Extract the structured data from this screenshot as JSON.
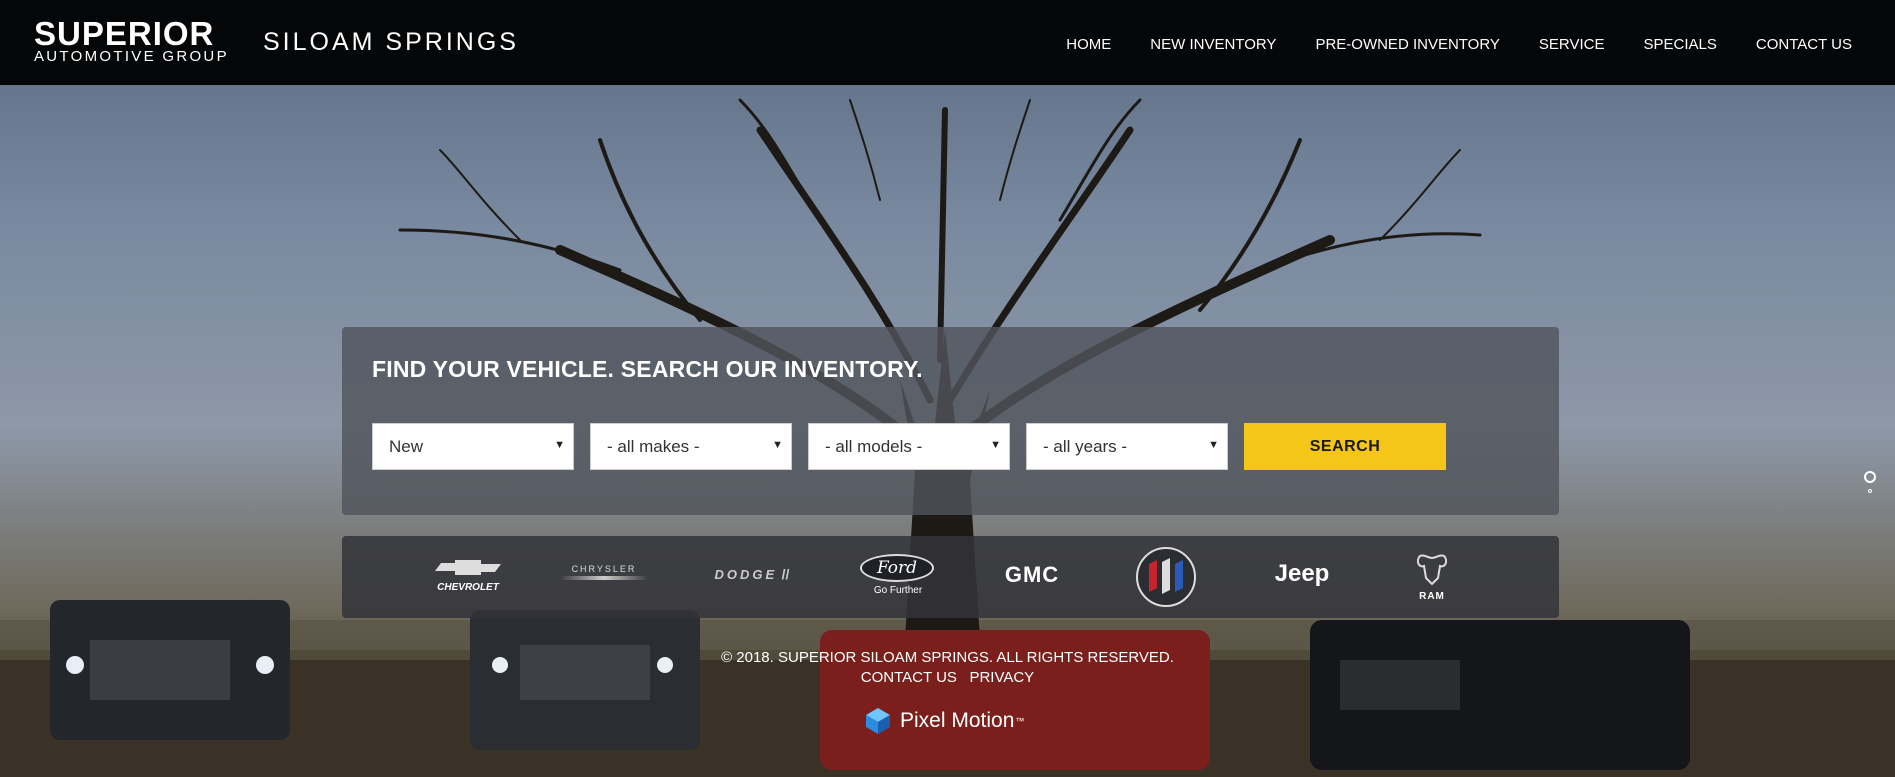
{
  "header": {
    "logo_top": "SUPERIOR",
    "logo_bottom": "AUTOMOTIVE GROUP",
    "location": "SILOAM SPRINGS",
    "nav": [
      "HOME",
      "NEW INVENTORY",
      "PRE-OWNED INVENTORY",
      "SERVICE",
      "SPECIALS",
      "CONTACT US"
    ]
  },
  "search": {
    "title": "FIND YOUR VEHICLE. SEARCH OUR INVENTORY.",
    "condition": "New",
    "make": "- all makes -",
    "model": "- all models -",
    "year": "- all years -",
    "button": "SEARCH",
    "accent_color": "#f5c518"
  },
  "brands": {
    "chevrolet": "CHEVROLET",
    "chrysler": "CHRYSLER",
    "dodge": "DODGE",
    "ford": "Ford",
    "ford_tag": "Go Further",
    "gmc": "GMC",
    "buick": "buick-tri-shield-logo",
    "jeep": "Jeep",
    "ram": "RAM"
  },
  "footer": {
    "copyright": "© 2018. SUPERIOR SILOAM SPRINGS. ALL RIGHTS RESERVED.",
    "contact": "CONTACT US",
    "privacy": "PRIVACY",
    "credit": "Pixel Motion",
    "credit_tm": "™"
  }
}
